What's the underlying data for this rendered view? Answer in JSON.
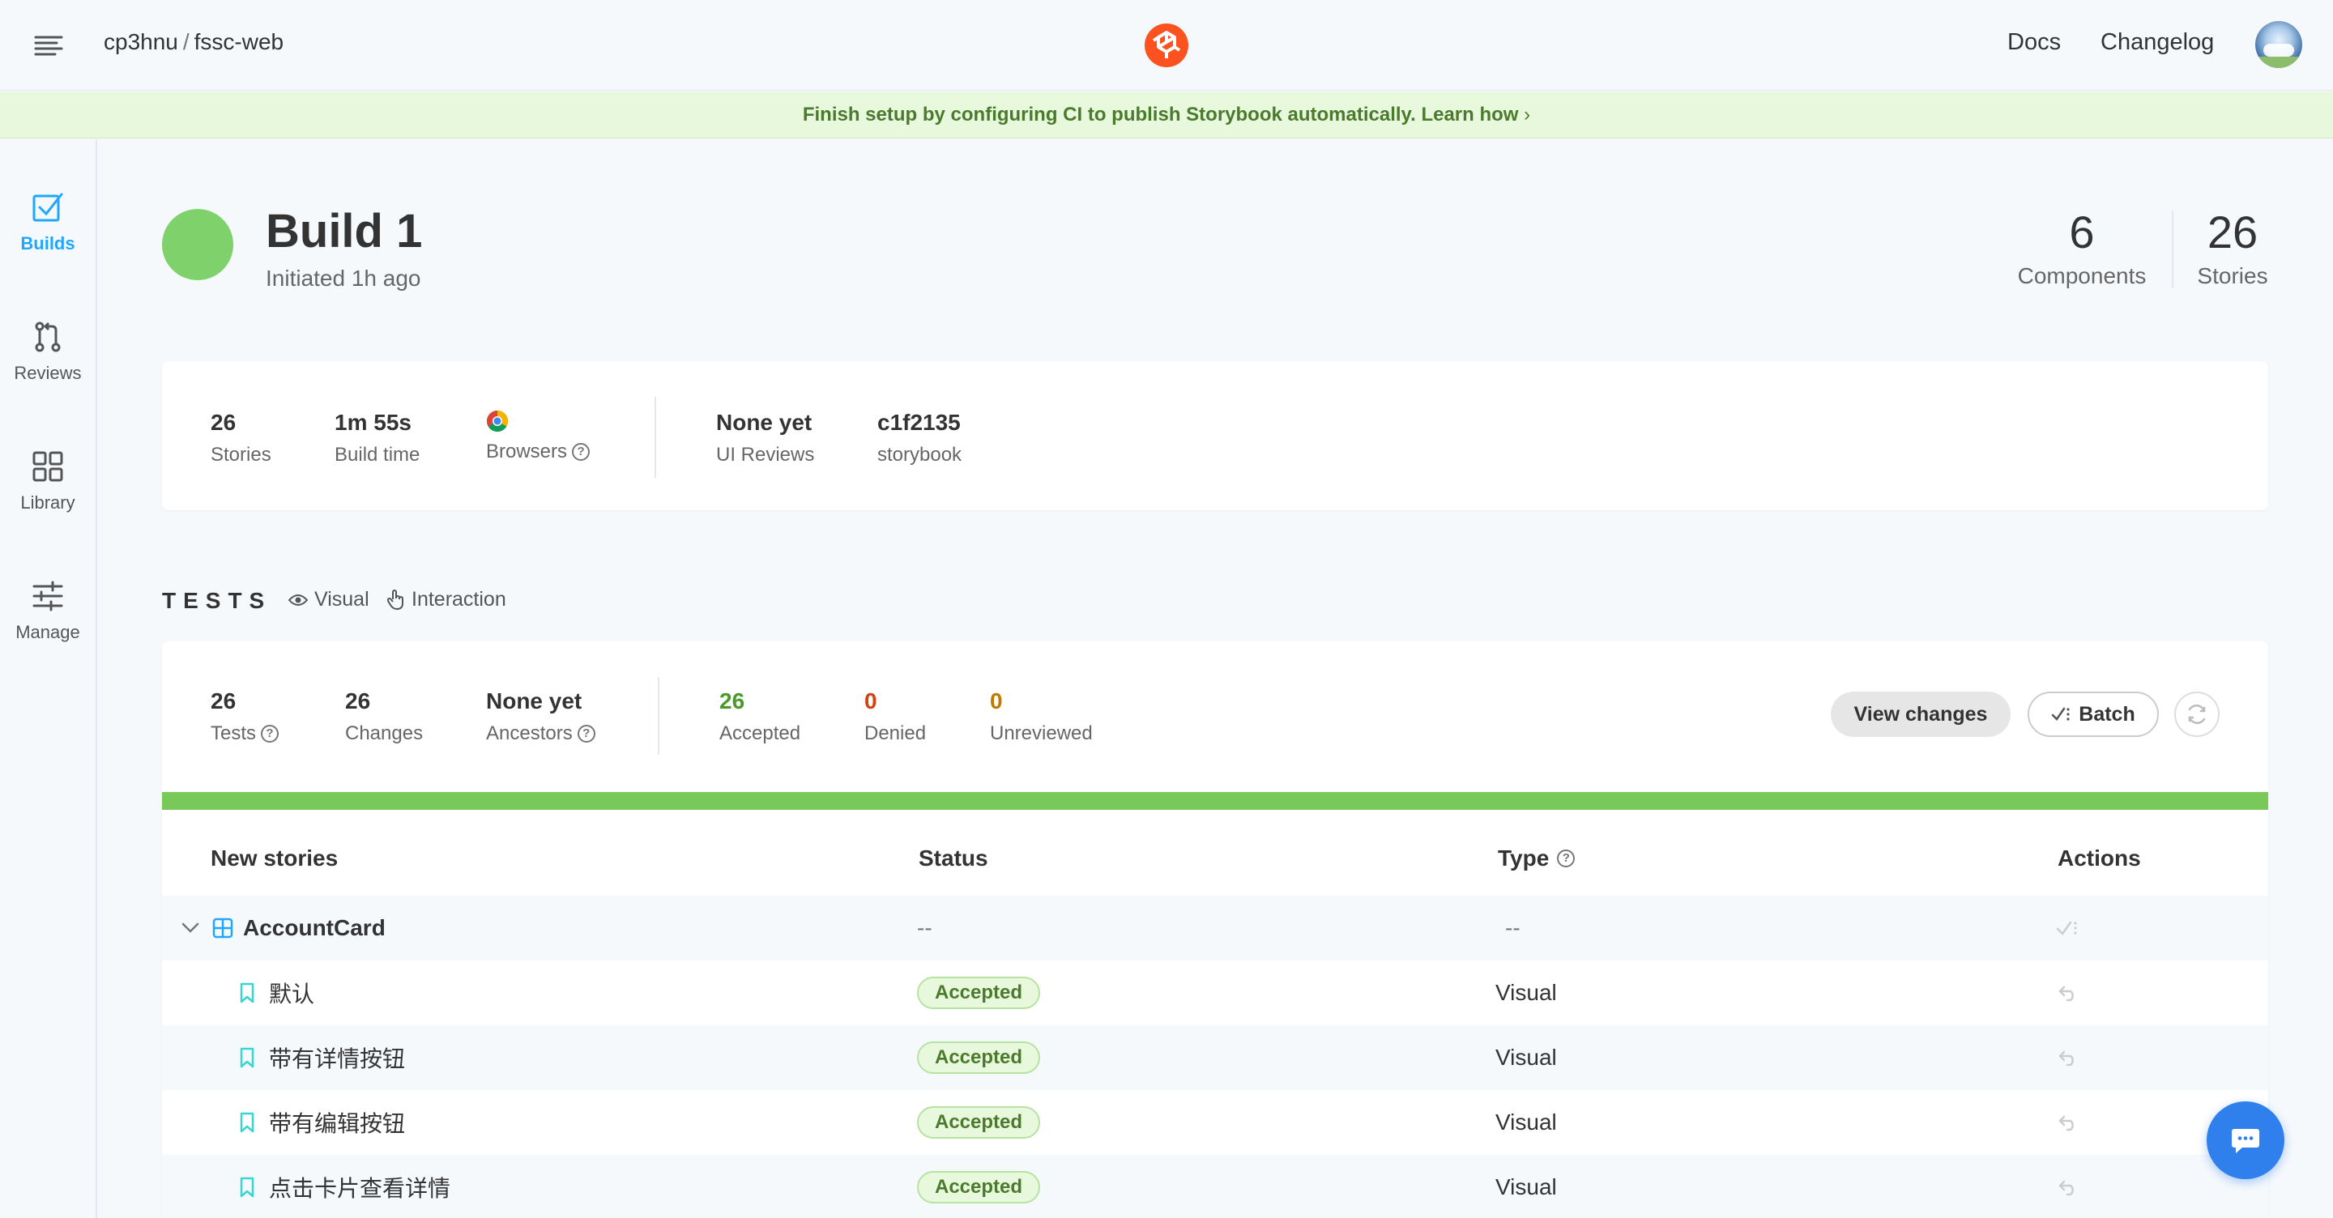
{
  "header": {
    "owner": "cp3hnu",
    "separator": "/",
    "repo": "fssc-web",
    "docs_label": "Docs",
    "changelog_label": "Changelog"
  },
  "banner": {
    "text": "Finish setup by configuring CI to publish Storybook automatically.",
    "link": "Learn how"
  },
  "sidebar": {
    "items": [
      {
        "label": "Builds",
        "icon": "checkbox-icon",
        "active": true
      },
      {
        "label": "Reviews",
        "icon": "pull-request-icon",
        "active": false
      },
      {
        "label": "Library",
        "icon": "grid-icon",
        "active": false
      },
      {
        "label": "Manage",
        "icon": "sliders-icon",
        "active": false
      }
    ]
  },
  "build": {
    "title": "Build 1",
    "subtitle": "Initiated 1h ago",
    "status_color": "#7fd16b",
    "components_count": "6",
    "components_label": "Components",
    "stories_count": "26",
    "stories_label": "Stories"
  },
  "summary": {
    "stories_value": "26",
    "stories_label": "Stories",
    "build_time_value": "1m 55s",
    "build_time_label": "Build time",
    "browsers_label": "Browsers",
    "ui_reviews_value": "None yet",
    "ui_reviews_label": "UI Reviews",
    "commit_value": "c1f2135",
    "commit_label": "storybook"
  },
  "tests": {
    "heading": "TESTS",
    "filter_visual": "Visual",
    "filter_interaction": "Interaction",
    "tests_value": "26",
    "tests_label": "Tests",
    "changes_value": "26",
    "changes_label": "Changes",
    "ancestors_value": "None yet",
    "ancestors_label": "Ancestors",
    "accepted_value": "26",
    "accepted_label": "Accepted",
    "denied_value": "0",
    "denied_label": "Denied",
    "unreviewed_value": "0",
    "unreviewed_label": "Unreviewed",
    "view_changes_label": "View changes",
    "batch_label": "Batch",
    "progress_accepted_fraction": 1.0
  },
  "table": {
    "col_stories": "New stories",
    "col_status": "Status",
    "col_type": "Type",
    "col_actions": "Actions",
    "group": {
      "name": "AccountCard",
      "status": "--",
      "type": "--"
    },
    "rows": [
      {
        "name": "默认",
        "status": "Accepted",
        "type": "Visual"
      },
      {
        "name": "带有详情按钮",
        "status": "Accepted",
        "type": "Visual"
      },
      {
        "name": "带有编辑按钮",
        "status": "Accepted",
        "type": "Visual"
      },
      {
        "name": "点击卡片查看详情",
        "status": "Accepted",
        "type": "Visual"
      }
    ]
  },
  "colors": {
    "accent": "#1ea7fd",
    "success": "#66bf3c",
    "danger": "#ff4400",
    "warning": "#e69d00",
    "banner_bg": "#e8f8dd"
  }
}
